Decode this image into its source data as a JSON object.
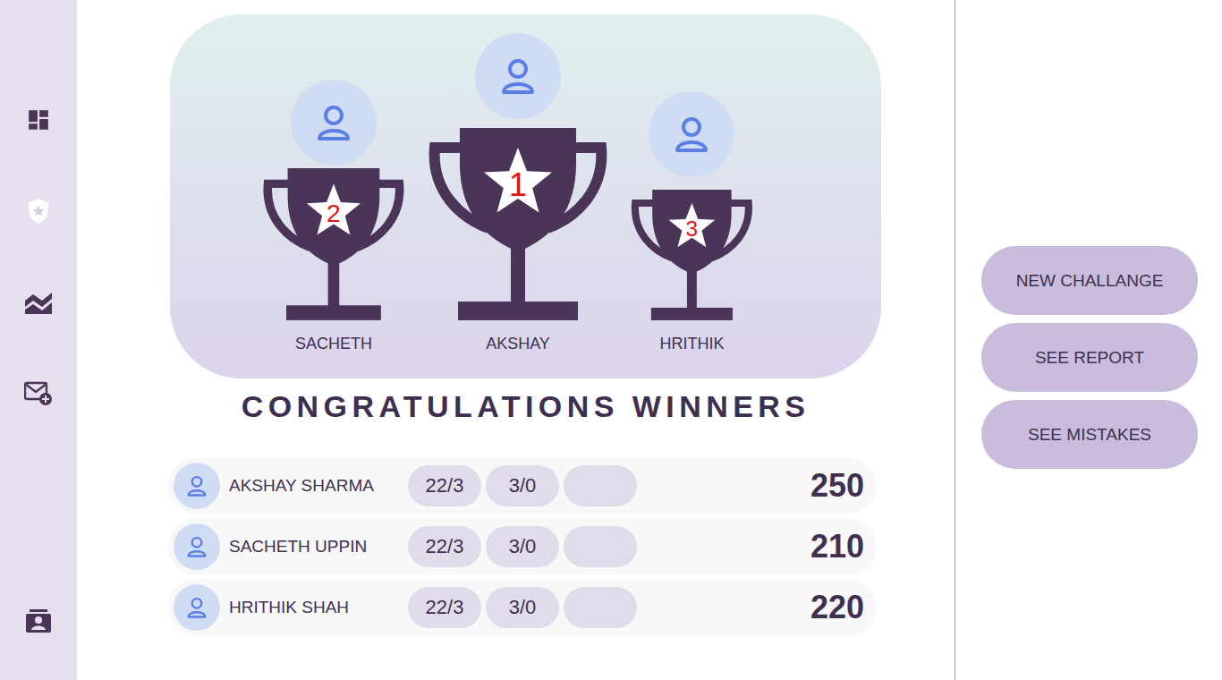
{
  "sidebar": {
    "items": [
      {
        "icon": "dashboard",
        "selected": false
      },
      {
        "icon": "badge",
        "selected": true
      },
      {
        "icon": "chart",
        "selected": false
      },
      {
        "icon": "mail",
        "selected": false
      },
      {
        "icon": "contacts",
        "selected": false
      }
    ]
  },
  "podium": [
    {
      "rank": "2",
      "name": "SACHETH"
    },
    {
      "rank": "1",
      "name": "AKSHAY"
    },
    {
      "rank": "3",
      "name": "HRITHIK"
    }
  ],
  "title": "CONGRATULATIONS WINNERS",
  "rows": [
    {
      "name": "AKSHAY SHARMA",
      "stats": [
        "22/3",
        "3/0",
        ""
      ],
      "score": "250"
    },
    {
      "name": "SACHETH UPPIN",
      "stats": [
        "22/3",
        "3/0",
        ""
      ],
      "score": "210"
    },
    {
      "name": "HRITHIK SHAH",
      "stats": [
        "22/3",
        "3/0",
        ""
      ],
      "score": "220"
    }
  ],
  "buttons": [
    "NEW CHALLANGE",
    "SEE REPORT",
    "SEE MISTAKES"
  ]
}
